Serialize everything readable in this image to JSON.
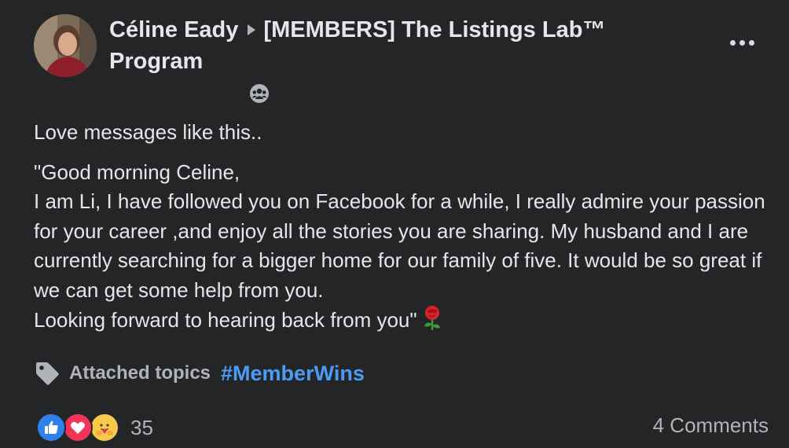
{
  "post": {
    "author": "Céline Eady",
    "group": "[MEMBERS] The Listings Lab™ Program",
    "intro": "Love messages like this..",
    "quote_lines": [
      "\"Good morning Celine,",
      "I am Li, I have followed you on Facebook for a while, I really admire your passion for your career ,and enjoy all the stories you are sharing. My husband and I are currently searching for a bigger home for our family of five. It would be so great if we can get some help from you.",
      "Looking forward to hearing back from you\""
    ],
    "emoji": "rose-emoji",
    "topics_label": "Attached topics",
    "hashtag": "#MemberWins",
    "reactions": [
      "like-icon",
      "love-icon",
      "care-icon"
    ],
    "reaction_count": "35",
    "comments": "4 Comments"
  },
  "colors": {
    "background": "#242526",
    "text": "#e4e6eb",
    "muted": "#b0b3b8",
    "link": "#4b9bf5"
  }
}
